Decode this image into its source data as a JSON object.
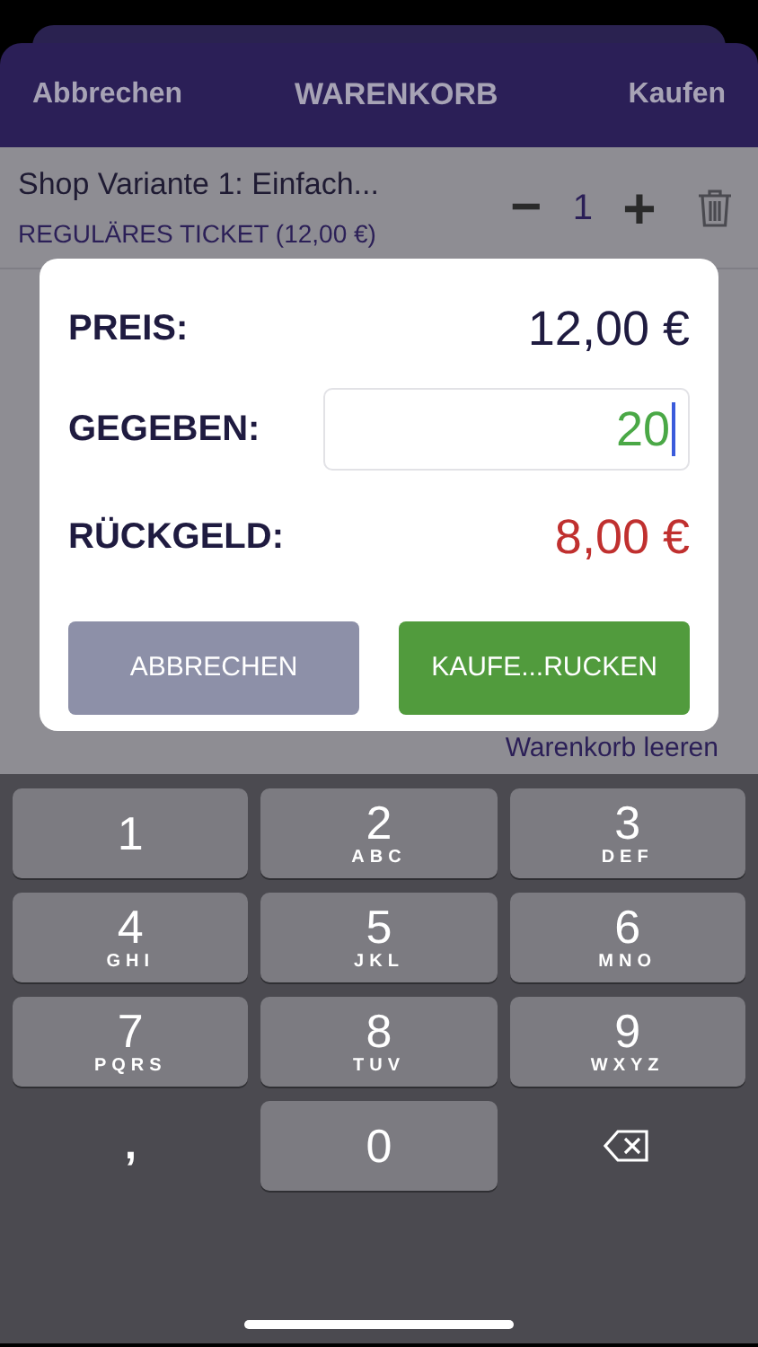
{
  "navbar": {
    "cancel": "Abbrechen",
    "title": "WARENKORB",
    "buy": "Kaufen"
  },
  "cart_item": {
    "name": "Shop Variante 1: Einfach...",
    "ticket": "REGULÄRES TICKET (12,00 €)",
    "decrement": "−",
    "quantity": "1",
    "increment": "+"
  },
  "clear_cart": "Warenkorb leeren",
  "dialog": {
    "price_label": "PREIS:",
    "price": "12,00 €",
    "given_label": "GEGEBEN:",
    "given": "20",
    "change_label": "RÜCKGELD:",
    "change": "8,00 €",
    "buttons": [
      {
        "label": "ABBRECHEN",
        "kind": "secondary"
      },
      {
        "label": "KAUFE...RUCKEN",
        "kind": "primary"
      }
    ]
  },
  "keyboard": [
    {
      "kind": "digit",
      "digit": "1"
    },
    {
      "kind": "digit",
      "digit": "2",
      "letters": "ABC"
    },
    {
      "kind": "digit",
      "digit": "3",
      "letters": "DEF"
    },
    {
      "kind": "digit",
      "digit": "4",
      "letters": "GHI"
    },
    {
      "kind": "digit",
      "digit": "5",
      "letters": "JKL"
    },
    {
      "kind": "digit",
      "digit": "6",
      "letters": "MNO"
    },
    {
      "kind": "digit",
      "digit": "7",
      "letters": "PQRS"
    },
    {
      "kind": "digit",
      "digit": "8",
      "letters": "TUV"
    },
    {
      "kind": "digit",
      "digit": "9",
      "letters": "WXYZ"
    },
    {
      "kind": "symbol",
      "digit": ","
    },
    {
      "kind": "digit",
      "digit": "0"
    },
    {
      "kind": "delete"
    }
  ]
}
